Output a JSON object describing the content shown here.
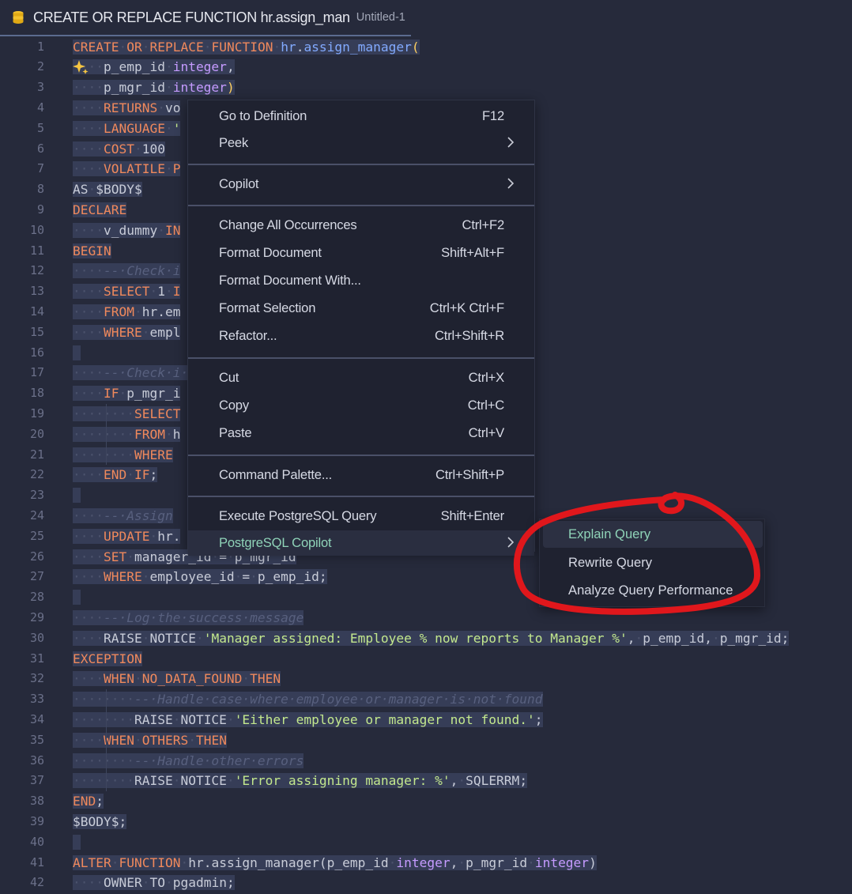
{
  "tab": {
    "title": "CREATE OR REPLACE FUNCTION hr.assign_man",
    "subtitle": "Untitled-1",
    "icon": "database-icon",
    "modified": true
  },
  "editor": {
    "line_numbers": [
      "1",
      "2",
      "3",
      "4",
      "5",
      "6",
      "7",
      "8",
      "9",
      "10",
      "11",
      "12",
      "13",
      "14",
      "15",
      "16",
      "17",
      "18",
      "19",
      "20",
      "21",
      "22",
      "23",
      "24",
      "25",
      "26",
      "27",
      "28",
      "29",
      "30",
      "31",
      "32",
      "33",
      "34",
      "35",
      "36",
      "37",
      "38",
      "39",
      "40",
      "41",
      "42"
    ],
    "visible_code": [
      "CREATE OR REPLACE FUNCTION hr.assign_manager(",
      "    p_emp_id integer,",
      "    p_mgr_id integer)",
      "    RETURNS vo",
      "    LANGUAGE '",
      "    COST 100",
      "    VOLATILE P",
      "AS $BODY$",
      "DECLARE",
      "    v_dummy IN",
      "BEGIN",
      "    -- Check i",
      "    SELECT 1 I",
      "    FROM hr.em",
      "    WHERE empl",
      "",
      "    -- Check i                                       LL)",
      "    IF p_mgr_i",
      "        SELECT",
      "        FROM h",
      "        WHERE",
      "    END IF;",
      "",
      "    -- Assign",
      "    UPDATE hr.",
      "    SET manager_id = p_mgr_id",
      "    WHERE employee_id = p_emp_id;",
      "",
      "    -- Log the success message",
      "    RAISE NOTICE 'Manager assigned: Employee % now reports to Manager %', p_emp_id, p_mgr_id;",
      "EXCEPTION",
      "    WHEN NO_DATA_FOUND THEN",
      "        -- Handle case where employee or manager is not found",
      "        RAISE NOTICE 'Either employee or manager not found.';",
      "    WHEN OTHERS THEN",
      "        -- Handle other errors",
      "        RAISE NOTICE 'Error assigning manager: %', SQLERRM;",
      "END;",
      "$BODY$;",
      "",
      "ALTER FUNCTION hr.assign_manager(p_emp_id integer, p_mgr_id integer)",
      "    OWNER TO pgadmin;"
    ]
  },
  "context_menu": {
    "groups": [
      [
        {
          "label": "Go to Definition",
          "key": "F12"
        },
        {
          "label": "Peek",
          "submenu": true
        }
      ],
      [
        {
          "label": "Copilot",
          "submenu": true
        }
      ],
      [
        {
          "label": "Change All Occurrences",
          "key": "Ctrl+F2"
        },
        {
          "label": "Format Document",
          "key": "Shift+Alt+F"
        },
        {
          "label": "Format Document With...",
          "key": ""
        },
        {
          "label": "Format Selection",
          "key": "Ctrl+K Ctrl+F"
        },
        {
          "label": "Refactor...",
          "key": "Ctrl+Shift+R"
        }
      ],
      [
        {
          "label": "Cut",
          "key": "Ctrl+X"
        },
        {
          "label": "Copy",
          "key": "Ctrl+C"
        },
        {
          "label": "Paste",
          "key": "Ctrl+V"
        }
      ],
      [
        {
          "label": "Command Palette...",
          "key": "Ctrl+Shift+P"
        }
      ],
      [
        {
          "label": "Execute PostgreSQL Query",
          "key": "Shift+Enter"
        },
        {
          "label": "PostgreSQL Copilot",
          "submenu": true,
          "active": true
        }
      ]
    ]
  },
  "submenu": {
    "items": [
      {
        "label": "Explain Query",
        "active": true
      },
      {
        "label": "Rewrite Query"
      },
      {
        "label": "Analyze Query Performance"
      }
    ]
  },
  "colors": {
    "editor_bg": "#262a3b",
    "menu_bg": "#1f2230",
    "keyword": "#f0895c",
    "type": "#c59bff",
    "string": "#c3e88d",
    "annotation": "#e0171c",
    "active_item": "#8fd3b8"
  }
}
